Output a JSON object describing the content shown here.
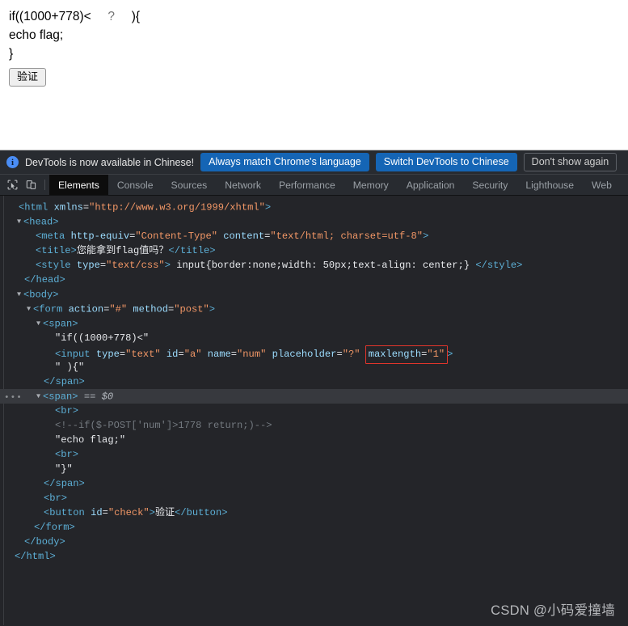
{
  "rendered_page": {
    "line1_prefix": "if((1000+778)<",
    "input_placeholder": "?",
    "input_value": "",
    "line1_suffix": "){",
    "line2": "echo flag;",
    "line3": "}",
    "verify_button_label": "验证"
  },
  "devtools": {
    "banner": {
      "info_icon": "info-icon",
      "message": "DevTools is now available in Chinese!",
      "primary_button": "Always match Chrome's language",
      "secondary_button": "Switch DevTools to Chinese",
      "dismiss_button": "Don't show again"
    },
    "toolbar": {
      "inspect_icon": "inspect-cursor-icon",
      "device_toolbar_icon": "device-toolbar-icon"
    },
    "tabs": [
      {
        "label": "Elements",
        "active": true
      },
      {
        "label": "Console",
        "active": false
      },
      {
        "label": "Sources",
        "active": false
      },
      {
        "label": "Network",
        "active": false
      },
      {
        "label": "Performance",
        "active": false
      },
      {
        "label": "Memory",
        "active": false
      },
      {
        "label": "Application",
        "active": false
      },
      {
        "label": "Security",
        "active": false
      },
      {
        "label": "Lighthouse",
        "active": false
      },
      {
        "label": "Web",
        "active": false
      }
    ],
    "accent_color": "#1565b5",
    "background_color": "#242529",
    "highlight_color": "#e1352b",
    "selected_row_color": "#37393e",
    "tree": {
      "html_open_tag": "<html",
      "html_xmlns_attr": "xmlns",
      "html_xmlns_value": "\"http://www.w3.org/1999/xhtml\"",
      "html_open_close": ">",
      "head_open": "<head>",
      "meta_tag": "<meta",
      "meta_attr1": "http-equiv",
      "meta_val1": "\"Content-Type\"",
      "meta_attr2": "content",
      "meta_val2": "\"text/html; charset=utf-8\"",
      "meta_close": ">",
      "title_open": "<title>",
      "title_text": "您能拿到flag值吗？",
      "title_close": "</title>",
      "style_open": "<style",
      "style_attr": "type",
      "style_val": "\"text/css\"",
      "style_gt": ">",
      "style_content": " input{border:none;width: 50px;text-align: center;} ",
      "style_close": "</style>",
      "head_close": "</head>",
      "body_open": "<body>",
      "form_open": "<form",
      "form_attr1": "action",
      "form_val1": "\"#\"",
      "form_attr2": "method",
      "form_val2": "\"post\"",
      "form_gt": ">",
      "span1_open": "<span>",
      "text_if": "\"if((1000+778)<\"",
      "input_open": "<input",
      "input_attr1": "type",
      "input_val1": "\"text\"",
      "input_attr2": "id",
      "input_val2": "\"a\"",
      "input_attr3": "name",
      "input_val3": "\"num\"",
      "input_attr4": "placeholder",
      "input_val4": "\"?\"",
      "input_attr5": "maxlength",
      "input_val5": "\"1\"",
      "input_gt": ">",
      "text_brace": "\" ){\"",
      "span1_close": "</span>",
      "span2_open": "<span>",
      "span2_selected_marker": "== $0",
      "br1": "<br>",
      "comment": "<!--if($-POST['num']>1778 return;)-->",
      "text_echo": "\"echo flag;\"",
      "br2": "<br>",
      "text_closebrace": "\"}\"",
      "span2_close": "</span>",
      "br3": "<br>",
      "button_open": "<button",
      "button_attr": "id",
      "button_val": "\"check\"",
      "button_gt": ">",
      "button_text": "验证",
      "button_close": "</button>",
      "form_close": "</form>",
      "body_close": "</body>",
      "html_close": "</html>"
    }
  },
  "watermark": "CSDN @小码爱撞墙"
}
